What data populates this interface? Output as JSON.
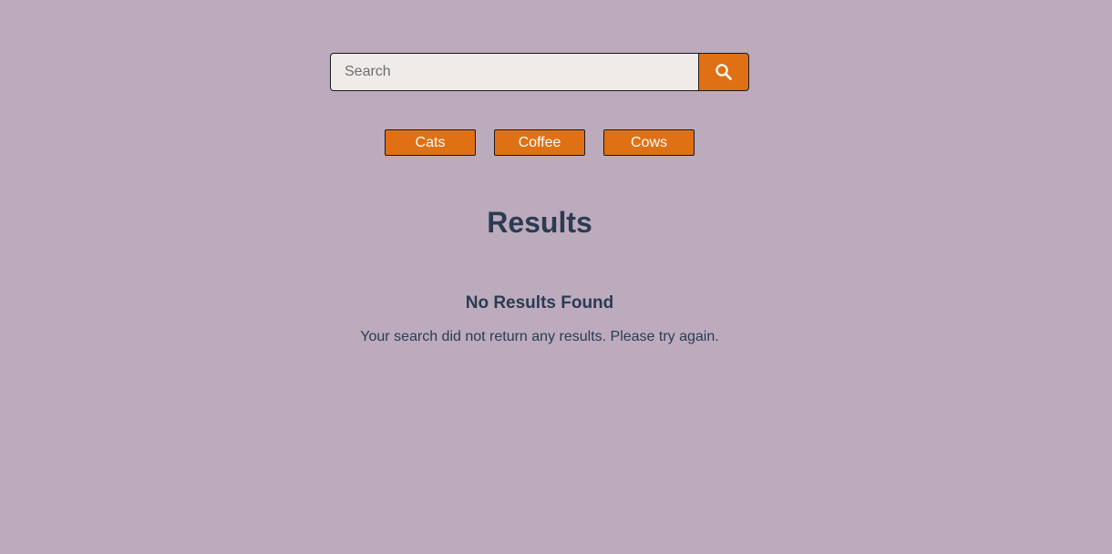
{
  "search": {
    "placeholder": "Search",
    "value": "",
    "button_icon": "search-icon"
  },
  "tags": [
    {
      "label": "Cats"
    },
    {
      "label": "Coffee"
    },
    {
      "label": "Cows"
    }
  ],
  "results": {
    "title": "Results",
    "empty_title": "No Results Found",
    "empty_message": "Your search did not return any results. Please try again."
  },
  "colors": {
    "background": "#bcabbd",
    "accent": "#e07014",
    "input_background": "#efebe8",
    "text": "#2b3b52"
  }
}
